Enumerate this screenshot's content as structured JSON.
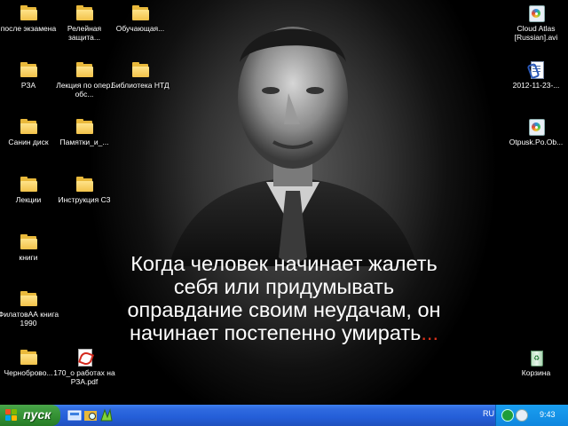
{
  "desktop": {
    "caption": {
      "text": "Когда человек начинает жалеть себя или придумывать оправдание своим неудачам, он начинает постепенно умирать",
      "ellipsis": "...",
      "ellipsis_color": "#e0331c"
    },
    "icons": [
      {
        "label": "после экзамена",
        "type": "folder-icon"
      },
      {
        "label": "Релейная защита...",
        "type": "folder-icon"
      },
      {
        "label": "Обучающая...",
        "type": "folder-icon"
      },
      {
        "label": "РЗА",
        "type": "folder-icon"
      },
      {
        "label": "Лекция по опер. обс...",
        "type": "folder-icon"
      },
      {
        "label": "Библиотека НТД",
        "type": "folder-icon"
      },
      {
        "label": "Санин диск",
        "type": "folder-icon"
      },
      {
        "label": "Памятки_и_...",
        "type": "folder-icon"
      },
      {
        "label": "Лекции",
        "type": "folder-icon"
      },
      {
        "label": "Инструкция С3",
        "type": "folder-icon"
      },
      {
        "label": "книги",
        "type": "folder-icon"
      },
      {
        "label": "ФилатовАА книга 1990",
        "type": "folder-icon"
      },
      {
        "label": "Черноброво...",
        "type": "folder-icon"
      },
      {
        "label": "170_о работах на РЗА.pdf",
        "type": "pdf-icon"
      },
      {
        "label": "Cloud Atlas [Russian].avi",
        "type": "media-file-icon"
      },
      {
        "label": "2012-11-23-...",
        "type": "document-icon"
      },
      {
        "label": "Otpusk.Po.Ob...",
        "type": "media-file-icon"
      },
      {
        "label": "Корзина",
        "type": "recycle-bin-icon"
      }
    ]
  },
  "taskbar": {
    "start_label": "пуск",
    "quick_launch": [
      "show-desktop-icon",
      "explorer-icon",
      "media-player-icon"
    ],
    "language": "RU",
    "clock": "9:43",
    "tray_icons": [
      "network-icon",
      "volume-icon"
    ]
  },
  "colors": {
    "taskbar": "#245ed8",
    "start_button": "#3c9a3c",
    "tray": "#0f86df"
  }
}
